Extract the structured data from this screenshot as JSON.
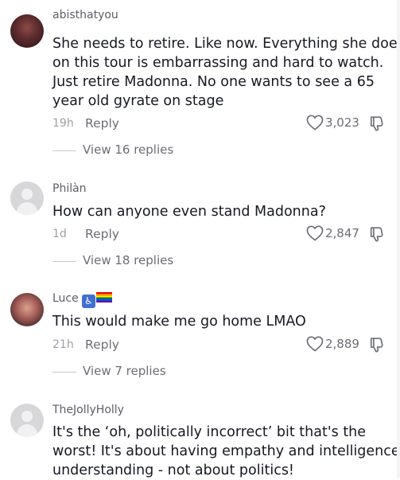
{
  "comments": [
    {
      "username": "abisthatyou",
      "lines": [
        "She needs to retire. Like now. Everything she does",
        "on this tour is embarrassing and hard to watch.",
        "Just retire Madonna. No one wants to see a 65",
        "year old gyrate on stage"
      ],
      "time": "19h",
      "reply_label": "Reply",
      "likes": "3,023",
      "view_replies": "View 16 replies"
    },
    {
      "username": "Philàn",
      "lines": [
        "How can anyone even stand Madonna?"
      ],
      "time": "1d",
      "reply_label": "Reply",
      "likes": "2,847",
      "view_replies": "View 18 replies"
    },
    {
      "username": "Luce",
      "badge_wheelchair": "♿",
      "lines": [
        "This would make me go home LMAO"
      ],
      "time": "21h",
      "reply_label": "Reply",
      "likes": "2,889",
      "view_replies": "View 7 replies"
    },
    {
      "username": "TheJollyHolly",
      "lines": [
        "It's the ‘oh, politically incorrect’ bit that's the",
        "worst! It's about having empathy and intelligence/",
        "understanding - not about politics!"
      ]
    }
  ],
  "icons": {
    "like": "heart-outline-icon",
    "dislike": "thumbs-down-icon"
  },
  "colors": {
    "text": "#161823",
    "muted": "#6b6d74",
    "username": "#5c5e66"
  }
}
